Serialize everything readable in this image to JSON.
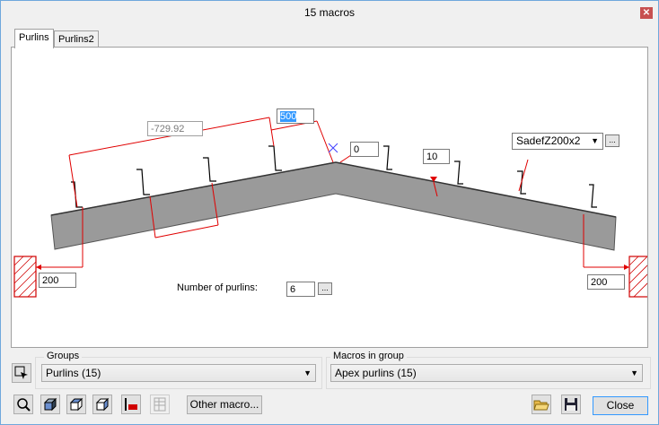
{
  "window": {
    "title": "15 macros"
  },
  "tabs": [
    {
      "label": "Purlins"
    },
    {
      "label": "Purlins2"
    }
  ],
  "drawing": {
    "dim_left_spacing": "-729.92",
    "dim_first_offset": "500",
    "dim_apex_offset": "0",
    "dim_slope_offset": "10",
    "left_support_distance": "200",
    "right_support_distance": "200",
    "profile": "SadefZ200x2",
    "number_of_purlins_label": "Number of purlins:",
    "number_of_purlins": "6",
    "dots_label": "..."
  },
  "groups": {
    "label": "Groups",
    "selected": "Purlins (15)"
  },
  "macros": {
    "label": "Macros in group",
    "selected": "Apex purlins (15)"
  },
  "buttons": {
    "other_macro": "Other macro...",
    "close": "Close"
  },
  "colors": {
    "dimension": "#e00000",
    "beam": "#9a9a9a",
    "selection": "#3399ff"
  }
}
